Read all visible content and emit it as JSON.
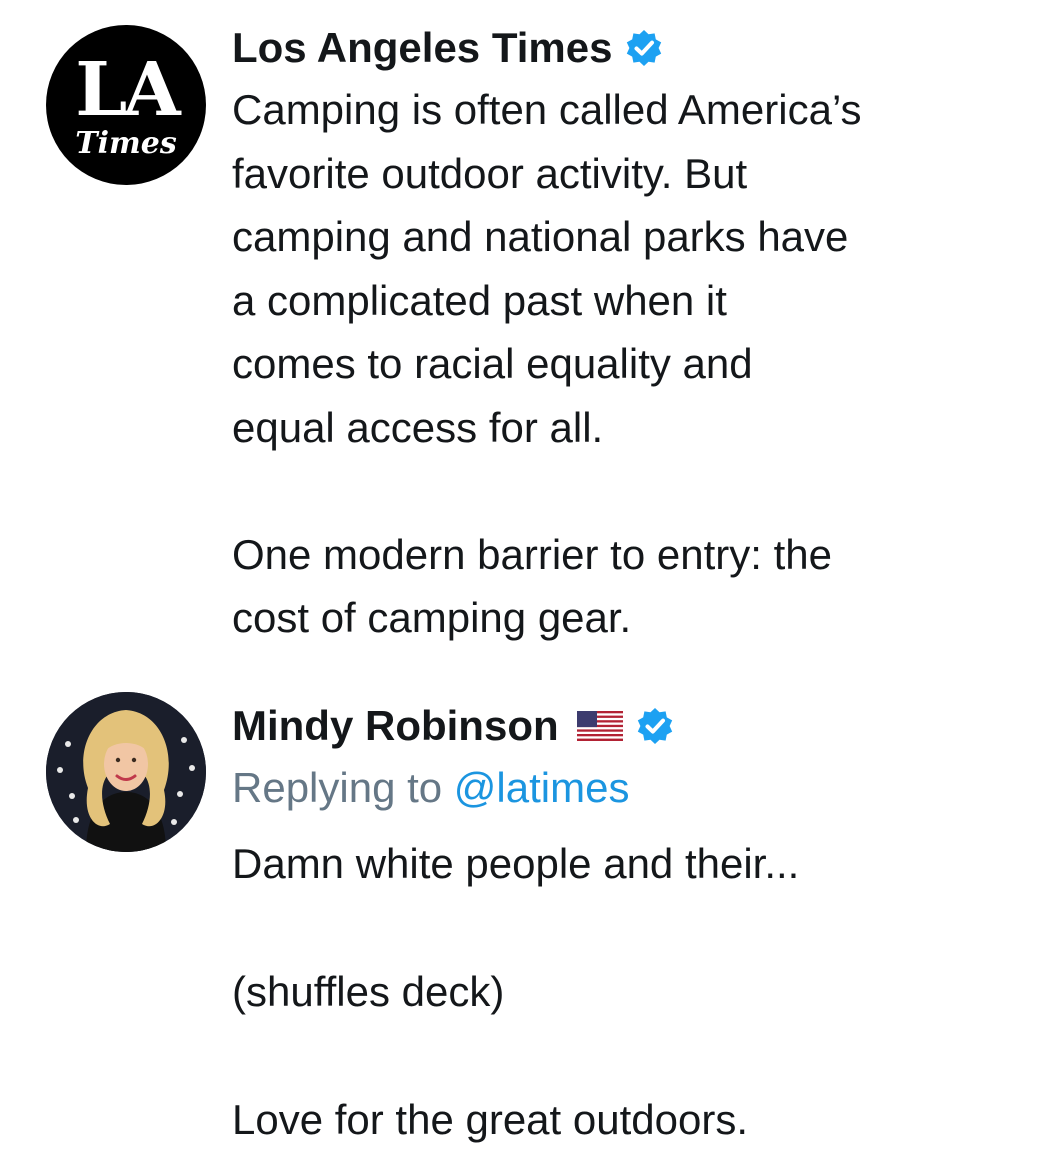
{
  "tweets": [
    {
      "author": "Los Angeles Times",
      "verified": true,
      "avatar": {
        "logo_line1": "LA",
        "logo_line2": "Times"
      },
      "text": "Camping is often called America’s\nfavorite outdoor activity. But\ncamping and national parks have\na complicated past when it\ncomes to racial equality and\nequal access for all.\n\nOne modern barrier to entry: the\ncost of camping gear."
    },
    {
      "author": "Mindy Robinson",
      "flag": "us-flag-icon",
      "verified": true,
      "replying_prefix": "Replying to ",
      "replying_handle": "@latimes",
      "text": "Damn white people and their...\n\n(shuffles deck)\n\nLove for the great outdoors."
    }
  ],
  "colors": {
    "verified": "#1da1f2",
    "handle": "#1b95e0",
    "muted": "#657786",
    "text": "#14171a"
  }
}
